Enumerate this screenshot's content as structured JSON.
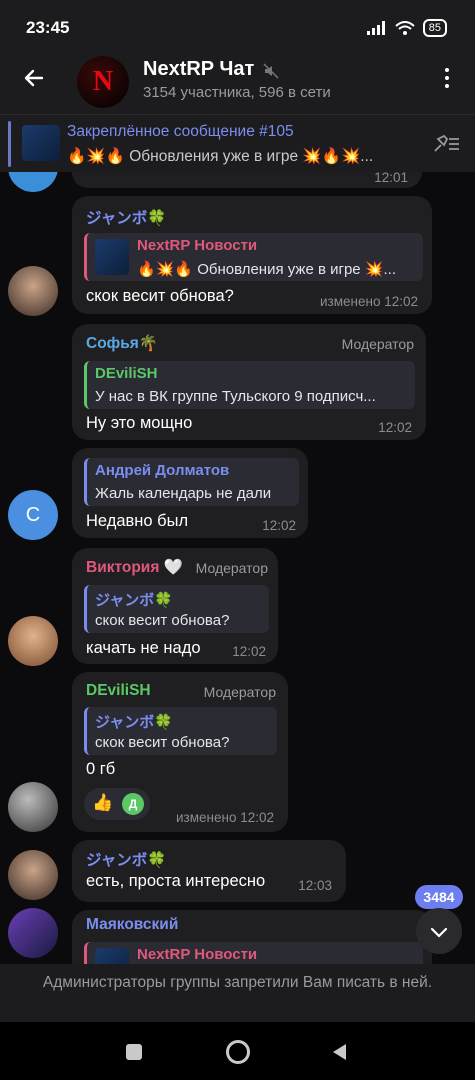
{
  "status": {
    "time": "23:45",
    "battery": "85"
  },
  "header": {
    "title": "NextRP Чат",
    "subtitle": "3154 участника, 596 в сети",
    "avatar_letter": "N"
  },
  "pinned": {
    "title": "Закреплённое сообщение #105",
    "text": "🔥💥🔥 Обновления уже в игре 💥🔥💥..."
  },
  "messages": {
    "m0": {
      "time": "12:01"
    },
    "m1": {
      "author": "ジャンボ🍀",
      "reply_author": "NextRP Новости",
      "reply_text": "🔥💥🔥 Обновления уже в игре 💥...",
      "text": "скок весит обнова?",
      "time": "изменено 12:02"
    },
    "m2": {
      "author": "Софья🌴",
      "role": "Модератор",
      "reply_author": "DEviliSH",
      "reply_text": "У нас в ВК группе Тульского 9 подписч...",
      "text": "Ну это мощно",
      "time": "12:02"
    },
    "m3": {
      "reply_author": "Андрей Долматов",
      "reply_text": "Жаль календарь не дали",
      "text": "Недавно был",
      "time": "12:02",
      "avatar_letter": "С"
    },
    "m4": {
      "author": "Виктория 🤍",
      "role": "Модератор",
      "reply_author": "ジャンボ🍀",
      "reply_text": "скок весит обнова?",
      "text": "качать не надо",
      "time": "12:02"
    },
    "m5": {
      "author": "DEviliSH",
      "role": "Модератор",
      "reply_author": "ジャンボ🍀",
      "reply_text": "скок весит обнова?",
      "text": "0 гб",
      "reaction": "👍",
      "reaction_letter": "Д",
      "time": "изменено 12:02"
    },
    "m6": {
      "author": "ジャンボ🍀",
      "text": "есть, проста интересно",
      "time": "12:03"
    },
    "m7": {
      "author": "Маяковский",
      "reply_author": "NextRP Новости"
    }
  },
  "scroll_badge": "3484",
  "notice": "Администраторы группы запретили Вам писать в ней.",
  "colors": {
    "accent": "#7b8ef0",
    "bubble": "#1f1f21",
    "background": "#0b0b0d"
  }
}
